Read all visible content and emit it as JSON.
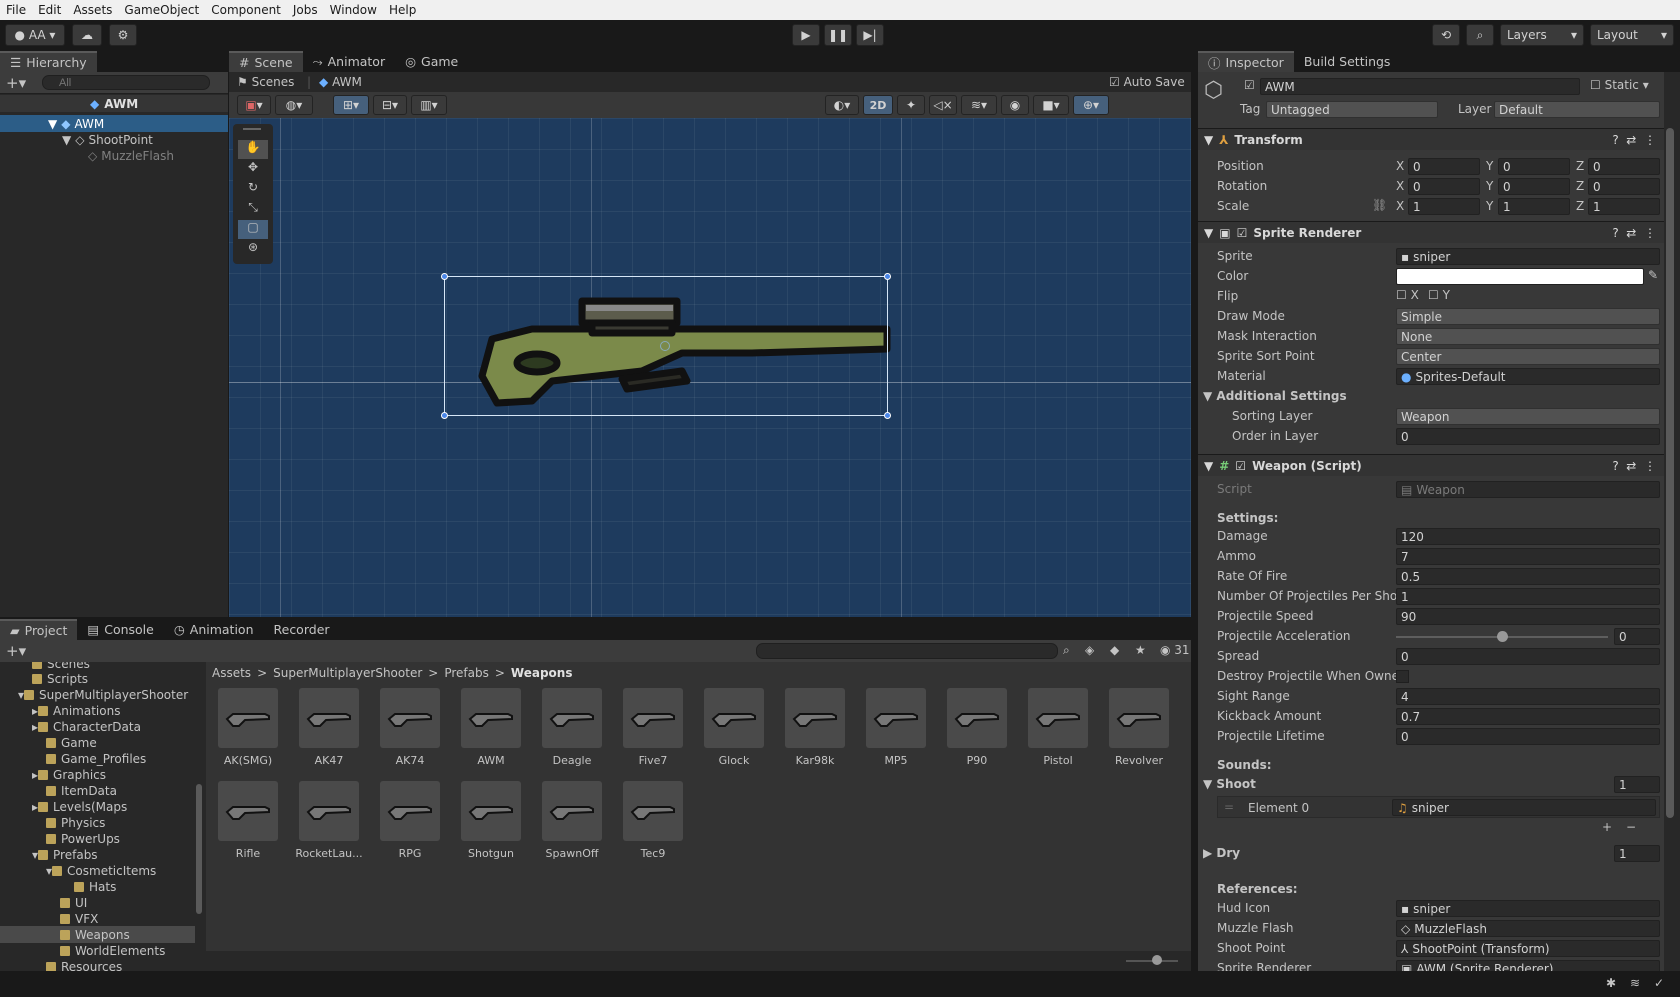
{
  "menu": [
    "File",
    "Edit",
    "Assets",
    "GameObject",
    "Component",
    "Jobs",
    "Window",
    "Help"
  ],
  "toolbar": {
    "account": "AA",
    "layers": "Layers",
    "layout": "Layout"
  },
  "hierarchy": {
    "tab": "Hierarchy",
    "search_placeholder": "All",
    "scene": "AWM",
    "items": [
      "AWM",
      "ShootPoint",
      "MuzzleFlash"
    ]
  },
  "scene": {
    "tabs": [
      "Scene",
      "Animator",
      "Game"
    ],
    "breadcrumb_root": "Scenes",
    "breadcrumb_current": "AWM",
    "autosave": "Auto Save",
    "mode2d": "2D"
  },
  "inspector": {
    "tabs": [
      "Inspector",
      "Build Settings"
    ],
    "object_name": "AWM",
    "static_label": "Static",
    "tag_label": "Tag",
    "tag": "Untagged",
    "layer_label": "Layer",
    "layer": "Default",
    "transform": {
      "title": "Transform",
      "rows": [
        {
          "label": "Position",
          "x": "0",
          "y": "0",
          "z": "0"
        },
        {
          "label": "Rotation",
          "x": "0",
          "y": "0",
          "z": "0"
        },
        {
          "label": "Scale",
          "x": "1",
          "y": "1",
          "z": "1"
        }
      ]
    },
    "sprite_renderer": {
      "title": "Sprite Renderer",
      "sprite_label": "Sprite",
      "sprite": "sniper",
      "color_label": "Color",
      "color": "#ffffff",
      "flip_label": "Flip",
      "flip_x": "X",
      "flip_y": "Y",
      "draw_mode_label": "Draw Mode",
      "draw_mode": "Simple",
      "mask_label": "Mask Interaction",
      "mask": "None",
      "sort_point_label": "Sprite Sort Point",
      "sort_point": "Center",
      "material_label": "Material",
      "material": "Sprites-Default",
      "additional": "Additional Settings",
      "sorting_layer_label": "Sorting Layer",
      "sorting_layer": "Weapon",
      "order_label": "Order in Layer",
      "order": "0"
    },
    "weapon": {
      "title": "Weapon (Script)",
      "script_label": "Script",
      "script": "Weapon",
      "settings": "Settings:",
      "fields": [
        {
          "label": "Damage",
          "value": "120"
        },
        {
          "label": "Ammo",
          "value": "7"
        },
        {
          "label": "Rate Of Fire",
          "value": "0.5"
        },
        {
          "label": "Number Of Projectiles Per Shot",
          "value": "1"
        },
        {
          "label": "Projectile Speed",
          "value": "90"
        },
        {
          "label": "Projectile Acceleration",
          "value": "0"
        },
        {
          "label": "Spread",
          "value": "0"
        },
        {
          "label": "Destroy Projectile When Owner",
          "value": ""
        },
        {
          "label": "Sight Range",
          "value": "4"
        },
        {
          "label": "Kickback Amount",
          "value": "0.7"
        },
        {
          "label": "Projectile Lifetime",
          "value": "0"
        }
      ],
      "sounds": "Sounds:",
      "shoot": "Shoot",
      "shoot_count": "1",
      "element0_label": "Element 0",
      "element0": "sniper",
      "dry": "Dry",
      "dry_count": "1",
      "references": "References:",
      "refs": [
        {
          "label": "Hud Icon",
          "value": "sniper"
        },
        {
          "label": "Muzzle Flash",
          "value": "MuzzleFlash"
        },
        {
          "label": "Shoot Point",
          "value": "ShootPoint (Transform)"
        },
        {
          "label": "Sprite Renderer",
          "value": "AWM (Sprite Renderer)"
        }
      ]
    }
  },
  "project": {
    "tabs": [
      "Project",
      "Console",
      "Animation",
      "Recorder"
    ],
    "count": "31",
    "breadcrumb": [
      "Assets",
      "SuperMultiplayerShooter",
      "Prefabs",
      "Weapons"
    ],
    "tree": [
      "Scenes",
      "Scripts",
      "SuperMultiplayerShooter",
      "Animations",
      "CharacterData",
      "Game",
      "Game_Profiles",
      "Graphics",
      "ItemData",
      "Levels(Maps",
      "Physics",
      "PowerUps",
      "Prefabs",
      "CosmeticItems",
      "Hats",
      "UI",
      "VFX",
      "Weapons",
      "WorldElements",
      "Resources"
    ],
    "assets": [
      "AK(SMG)",
      "AK47",
      "AK74",
      "AWM",
      "Deagle",
      "Five7",
      "Glock",
      "Kar98k",
      "MP5",
      "P90",
      "Pistol",
      "Revolver",
      "Rifle",
      "RocketLau...",
      "RPG",
      "Shotgun",
      "SpawnOff",
      "Tec9"
    ]
  }
}
